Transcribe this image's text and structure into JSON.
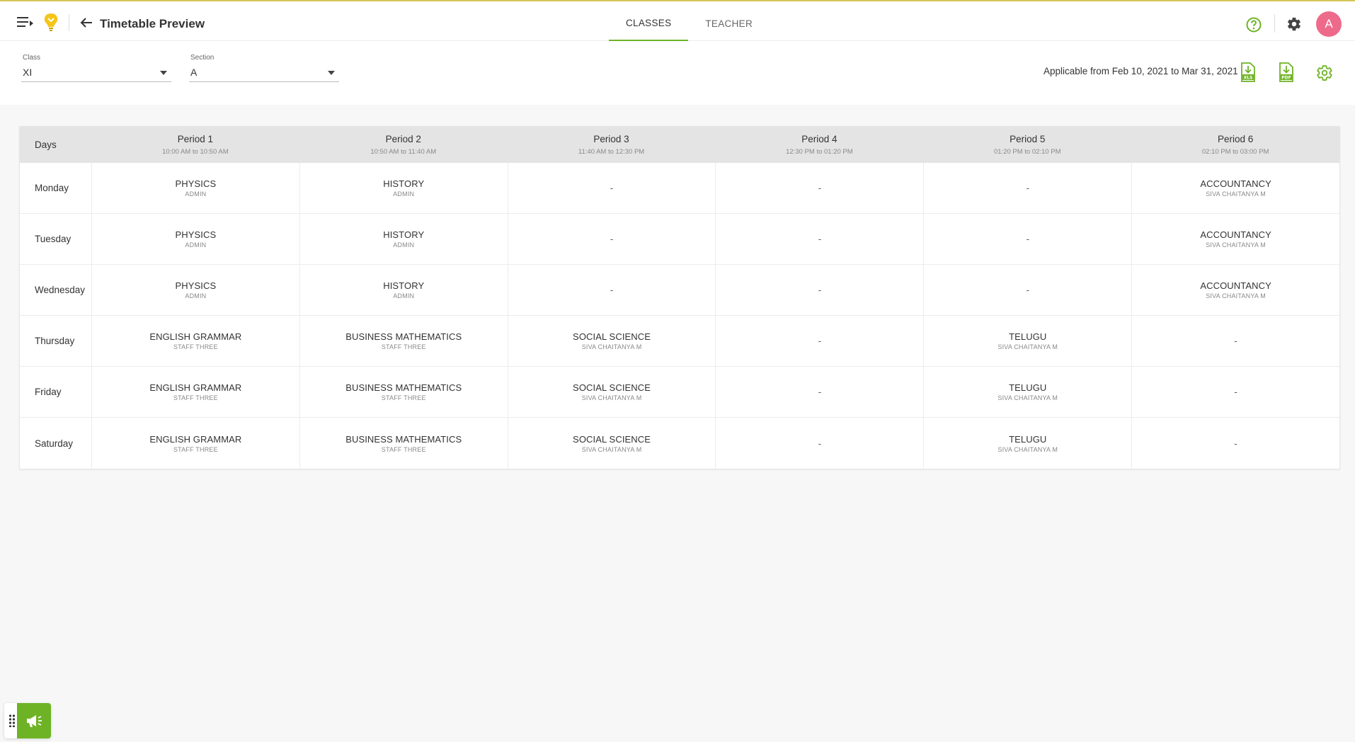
{
  "header": {
    "title": "Timetable Preview",
    "tabs": [
      {
        "label": "CLASSES",
        "active": true
      },
      {
        "label": "TEACHER",
        "active": false
      }
    ],
    "avatar_initial": "A",
    "accent_color": "#6eb325",
    "avatar_color": "#ee6a8a"
  },
  "filters": {
    "class": {
      "label": "Class",
      "value": "XI"
    },
    "section": {
      "label": "Section",
      "value": "A"
    },
    "applicable_text": "Applicable from Feb 10, 2021 to Mar 31, 2021",
    "icons": [
      "xls-download-icon",
      "pdf-download-icon",
      "settings-icon"
    ]
  },
  "timetable": {
    "days_header": "Days",
    "periods": [
      {
        "title": "Period 1",
        "time": "10:00 AM to 10:50 AM"
      },
      {
        "title": "Period 2",
        "time": "10:50 AM to 11:40 AM"
      },
      {
        "title": "Period 3",
        "time": "11:40 AM to 12:30 PM"
      },
      {
        "title": "Period 4",
        "time": "12:30 PM to 01:20 PM"
      },
      {
        "title": "Period 5",
        "time": "01:20 PM to 02:10 PM"
      },
      {
        "title": "Period 6",
        "time": "02:10 PM to 03:00 PM"
      }
    ],
    "rows": [
      {
        "day": "Monday",
        "cells": [
          {
            "subject": "PHYSICS",
            "teacher": "ADMIN"
          },
          {
            "subject": "HISTORY",
            "teacher": "ADMIN"
          },
          {
            "subject": "-",
            "teacher": ""
          },
          {
            "subject": "-",
            "teacher": ""
          },
          {
            "subject": "-",
            "teacher": ""
          },
          {
            "subject": "ACCOUNTANCY",
            "teacher": "SIVA CHAITANYA M"
          }
        ]
      },
      {
        "day": "Tuesday",
        "cells": [
          {
            "subject": "PHYSICS",
            "teacher": "ADMIN"
          },
          {
            "subject": "HISTORY",
            "teacher": "ADMIN"
          },
          {
            "subject": "-",
            "teacher": ""
          },
          {
            "subject": "-",
            "teacher": ""
          },
          {
            "subject": "-",
            "teacher": ""
          },
          {
            "subject": "ACCOUNTANCY",
            "teacher": "SIVA CHAITANYA M"
          }
        ]
      },
      {
        "day": "Wednesday",
        "cells": [
          {
            "subject": "PHYSICS",
            "teacher": "ADMIN"
          },
          {
            "subject": "HISTORY",
            "teacher": "ADMIN"
          },
          {
            "subject": "-",
            "teacher": ""
          },
          {
            "subject": "-",
            "teacher": ""
          },
          {
            "subject": "-",
            "teacher": ""
          },
          {
            "subject": "ACCOUNTANCY",
            "teacher": "SIVA CHAITANYA M"
          }
        ]
      },
      {
        "day": "Thursday",
        "cells": [
          {
            "subject": "ENGLISH GRAMMAR",
            "teacher": "STAFF THREE"
          },
          {
            "subject": "BUSINESS MATHEMATICS",
            "teacher": "STAFF THREE"
          },
          {
            "subject": "SOCIAL SCIENCE",
            "teacher": "SIVA CHAITANYA M"
          },
          {
            "subject": "-",
            "teacher": ""
          },
          {
            "subject": "TELUGU",
            "teacher": "SIVA CHAITANYA M"
          },
          {
            "subject": "-",
            "teacher": ""
          }
        ]
      },
      {
        "day": "Friday",
        "cells": [
          {
            "subject": "ENGLISH GRAMMAR",
            "teacher": "STAFF THREE"
          },
          {
            "subject": "BUSINESS MATHEMATICS",
            "teacher": "STAFF THREE"
          },
          {
            "subject": "SOCIAL SCIENCE",
            "teacher": "SIVA CHAITANYA M"
          },
          {
            "subject": "-",
            "teacher": ""
          },
          {
            "subject": "TELUGU",
            "teacher": "SIVA CHAITANYA M"
          },
          {
            "subject": "-",
            "teacher": ""
          }
        ]
      },
      {
        "day": "Saturday",
        "cells": [
          {
            "subject": "ENGLISH GRAMMAR",
            "teacher": "STAFF THREE"
          },
          {
            "subject": "BUSINESS MATHEMATICS",
            "teacher": "STAFF THREE"
          },
          {
            "subject": "SOCIAL SCIENCE",
            "teacher": "SIVA CHAITANYA M"
          },
          {
            "subject": "-",
            "teacher": ""
          },
          {
            "subject": "TELUGU",
            "teacher": "SIVA CHAITANYA M"
          },
          {
            "subject": "-",
            "teacher": ""
          }
        ]
      }
    ]
  },
  "widget": {
    "icons": [
      "drag-handle-icon",
      "megaphone-icon"
    ]
  }
}
